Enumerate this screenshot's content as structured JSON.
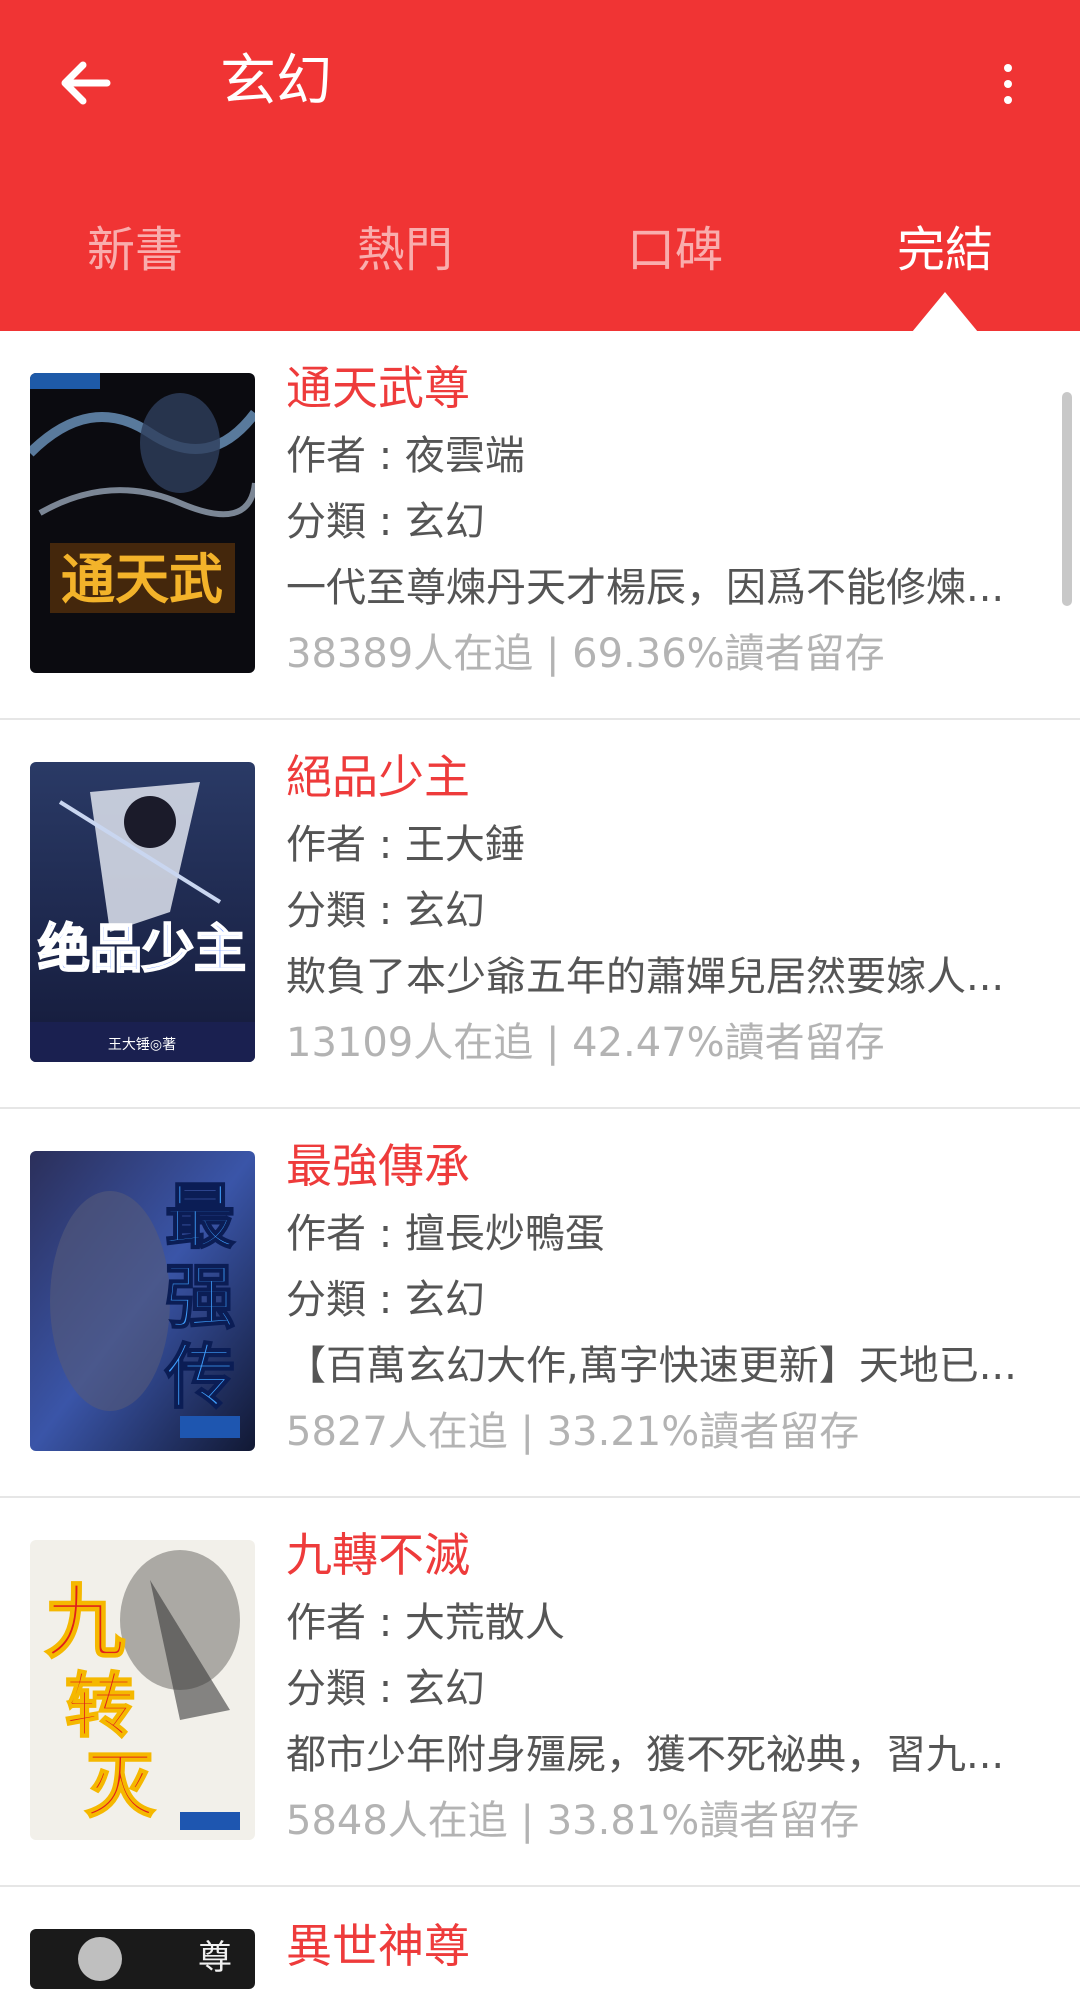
{
  "app": {
    "title": "玄幻",
    "accent": "#f03434",
    "back_icon": "arrow-left-icon",
    "more_icon": "more-vertical-icon"
  },
  "tabs": [
    {
      "label": "新書",
      "active": false
    },
    {
      "label": "熱門",
      "active": false
    },
    {
      "label": "口碑",
      "active": false
    },
    {
      "label": "完結",
      "active": true
    }
  ],
  "books": [
    {
      "title": "通天武尊",
      "author": "作者 : 夜雲端",
      "category": "分類 : 玄幻",
      "summary": "一代至尊煉丹天才楊辰，因爲不能修煉...",
      "stats": "38389人在追 | 69.36%讀者留存"
    },
    {
      "title": "絕品少主",
      "author": "作者 : 王大錘",
      "category": "分類 : 玄幻",
      "summary": "欺負了本少爺五年的蕭嬋兒居然要嫁人...",
      "stats": "13109人在追 | 42.47%讀者留存"
    },
    {
      "title": "最強傳承",
      "author": "作者 : 擅長炒鴨蛋",
      "category": "分類 : 玄幻",
      "summary": "【百萬玄幻大作,萬字快速更新】天地已...",
      "stats": "5827人在追 | 33.21%讀者留存"
    },
    {
      "title": "九轉不滅",
      "author": "作者 : 大荒散人",
      "category": "分類 : 玄幻",
      "summary": "都市少年附身殭屍，獲不死祕典，習九...",
      "stats": "5848人在追 | 33.81%讀者留存"
    },
    {
      "title": "異世神尊"
    }
  ]
}
